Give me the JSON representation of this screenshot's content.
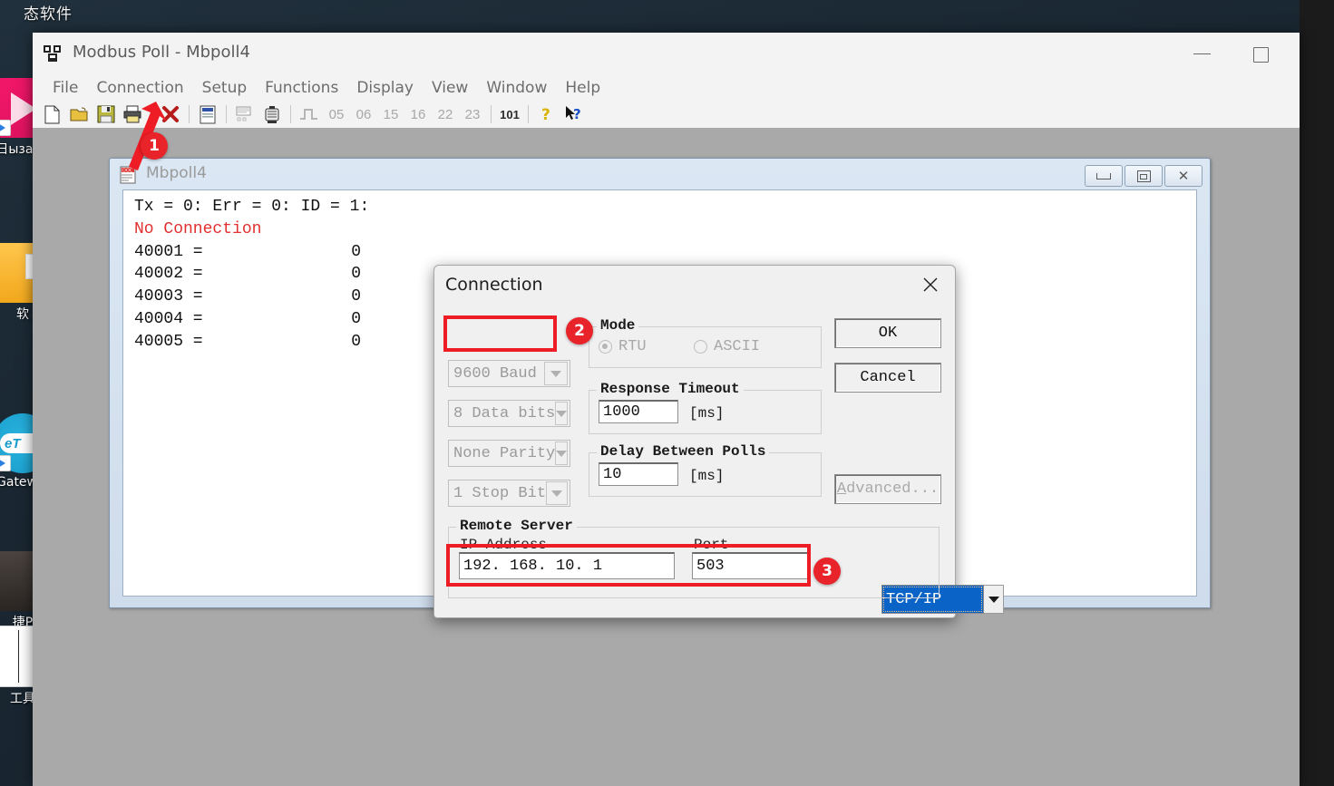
{
  "desktop": {
    "title_text": "态软件",
    "icons": [
      {
        "name": "video-player-shortcut",
        "caption": "日ызапи"
      },
      {
        "name": "folder-shortcut",
        "caption": "软"
      },
      {
        "name": "etgateway-shortcut",
        "caption": "iGateway"
      },
      {
        "name": "tool-shortcut",
        "caption": "捷P"
      },
      {
        "name": "tool-shortcut-2",
        "caption": "工具"
      }
    ]
  },
  "app": {
    "title": "Modbus Poll - Mbpoll4",
    "icon": "modbus-poll-icon",
    "caption_buttons": {
      "minimize": "minimize-icon",
      "maximize": "maximize-icon"
    },
    "menu": [
      "File",
      "Connection",
      "Setup",
      "Functions",
      "Display",
      "View",
      "Window",
      "Help"
    ],
    "toolbar": {
      "icons": [
        {
          "name": "new-file-icon",
          "label": "New"
        },
        {
          "name": "open-folder-icon",
          "label": "Open"
        },
        {
          "name": "save-icon",
          "label": "Save"
        },
        {
          "name": "print-icon",
          "label": "Print"
        },
        {
          "name": "disconnect-icon",
          "label": "Disconnect"
        },
        {
          "name": "read-write-definition-icon",
          "label": "Read/Write Definition"
        },
        {
          "name": "poll-definition-icon",
          "label": "Poll Definition"
        },
        {
          "name": "test-center-icon",
          "label": "Test Center"
        },
        {
          "name": "pulse-icon",
          "label": "Function 01"
        }
      ],
      "function_codes": [
        "05",
        "06",
        "15",
        "16",
        "22",
        "23"
      ],
      "binary_code": "101",
      "help_icons": [
        {
          "name": "help-icon",
          "label": "Help"
        },
        {
          "name": "context-help-icon",
          "label": "Context Help"
        }
      ]
    }
  },
  "mdi_child": {
    "icon": "document-icon",
    "title": "Mbpoll4",
    "status_line": "Tx = 0: Err = 0: ID = 1:",
    "connection_status": "No Connection",
    "registers": [
      {
        "address": "40001 =",
        "value": "0"
      },
      {
        "address": "40002 =",
        "value": "0"
      },
      {
        "address": "40003 =",
        "value": "0"
      },
      {
        "address": "40004 =",
        "value": "0"
      },
      {
        "address": "40005 =",
        "value": "0"
      }
    ],
    "buttons": {
      "minimize": "minimize-icon",
      "restore": "restore-icon",
      "close": "close-icon"
    }
  },
  "dialog": {
    "title": "Connection",
    "close_icon": "close-icon",
    "protocol": {
      "selected": "TCP/IP",
      "arrow": "chevron-down-icon"
    },
    "serial": [
      {
        "name": "baud-rate",
        "value": "9600 Baud"
      },
      {
        "name": "data-bits",
        "value": "8 Data bits"
      },
      {
        "name": "parity",
        "value": "None Parity"
      },
      {
        "name": "stop-bits",
        "value": "1 Stop Bit"
      }
    ],
    "mode": {
      "legend": "Mode",
      "options": [
        {
          "label": "RTU",
          "checked": true
        },
        {
          "label": "ASCII",
          "checked": false
        }
      ]
    },
    "response_timeout": {
      "legend": "Response Timeout",
      "value": "1000",
      "unit": "[ms]"
    },
    "delay_between_polls": {
      "legend": "Delay Between Polls",
      "value": "10",
      "unit": "[ms]"
    },
    "remote_server": {
      "legend": "Remote Server",
      "ip_label": "IP Address",
      "ip_value": "192. 168. 10. 1",
      "port_label": "Port",
      "port_value": "503"
    },
    "buttons": {
      "ok": "OK",
      "cancel": "Cancel",
      "advanced_prefix": "A",
      "advanced_rest": "dvanced..."
    }
  },
  "annotations": {
    "marker_1": "1",
    "marker_2": "2",
    "marker_3": "3",
    "accent_color": "#ee1c25"
  }
}
